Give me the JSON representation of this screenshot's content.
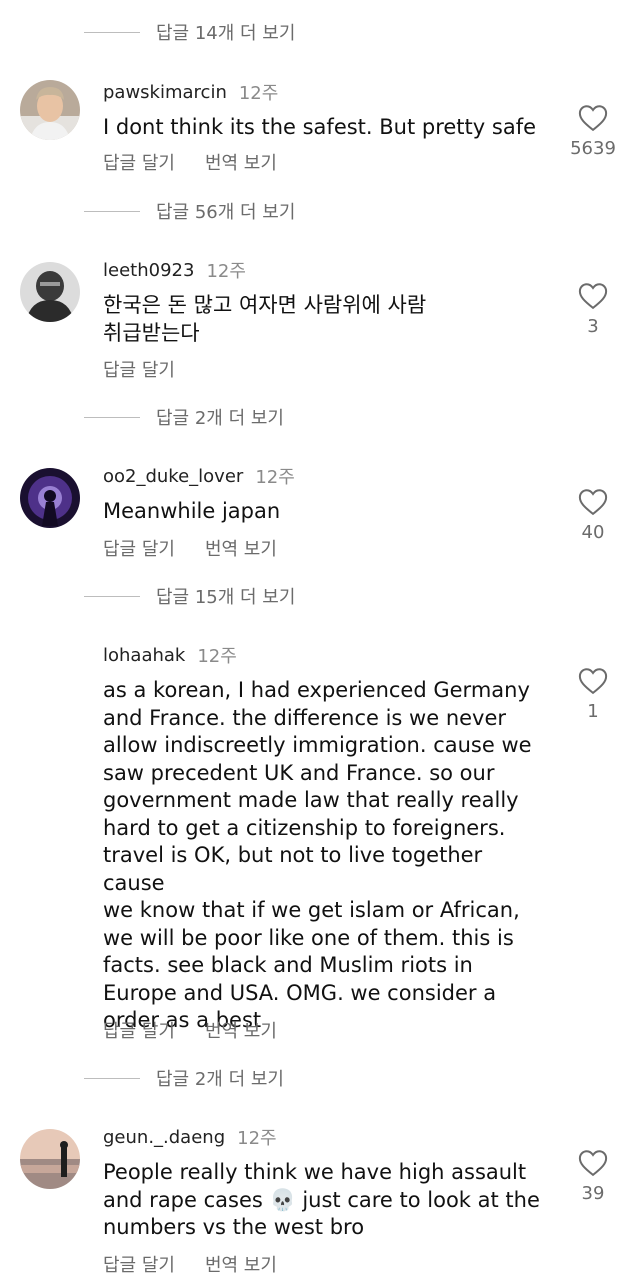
{
  "more_replies": [
    {
      "label": "답글 14개 더 보기"
    },
    {
      "label": "답글 56개 더 보기"
    },
    {
      "label": "답글 2개 더 보기"
    },
    {
      "label": "답글 15개 더 보기"
    },
    {
      "label": "답글 2개 더 보기"
    }
  ],
  "comments": [
    {
      "username": "pawskimarcin",
      "age": "12주",
      "text": "I dont think its the safest. But pretty safe",
      "reply_label": "답글 달기",
      "translate_label": "번역 보기",
      "likes": "5639",
      "avatar_icon": "user-photo-icon"
    },
    {
      "username": "leeth0923",
      "age": "12주",
      "text": "한국은 돈 많고 여자면 사람위에 사람\n취급받는다",
      "reply_label": "답글 달기",
      "likes": "3",
      "avatar_icon": "user-photo-icon"
    },
    {
      "username": "oo2_duke_lover",
      "age": "12주",
      "text": "Meanwhile japan",
      "reply_label": "답글 달기",
      "translate_label": "번역 보기",
      "likes": "40",
      "avatar_icon": "user-photo-icon"
    },
    {
      "username": "lohaahak",
      "age": "12주",
      "text": "as a korean, I had experienced Germany\nand France. the difference is we never\nallow indiscreetly immigration. cause we\nsaw precedent UK and France. so our\ngovernment made law that really really\nhard to get a citizenship to foreigners.\ntravel is OK, but not to live together cause\nwe know that if we get islam or African,\nwe will be poor like one of them. this is\nfacts. see black and Muslim riots in\nEurope and USA. OMG. we consider a\norder as a best",
      "reply_label": "답글 달기",
      "translate_label": "번역 보기",
      "likes": "1",
      "avatar_icon": "none"
    },
    {
      "username": "geun._.daeng",
      "age": "12주",
      "text": "People really think we have high assault\nand rape cases 💀 just care to look at the\nnumbers vs the west bro",
      "reply_label": "답글 달기",
      "translate_label": "번역 보기",
      "likes": "39",
      "avatar_icon": "user-photo-icon"
    }
  ],
  "colors": {
    "text": "#111111",
    "muted": "#6b6b6b",
    "divider": "#bdbdbd",
    "background": "#ffffff"
  }
}
